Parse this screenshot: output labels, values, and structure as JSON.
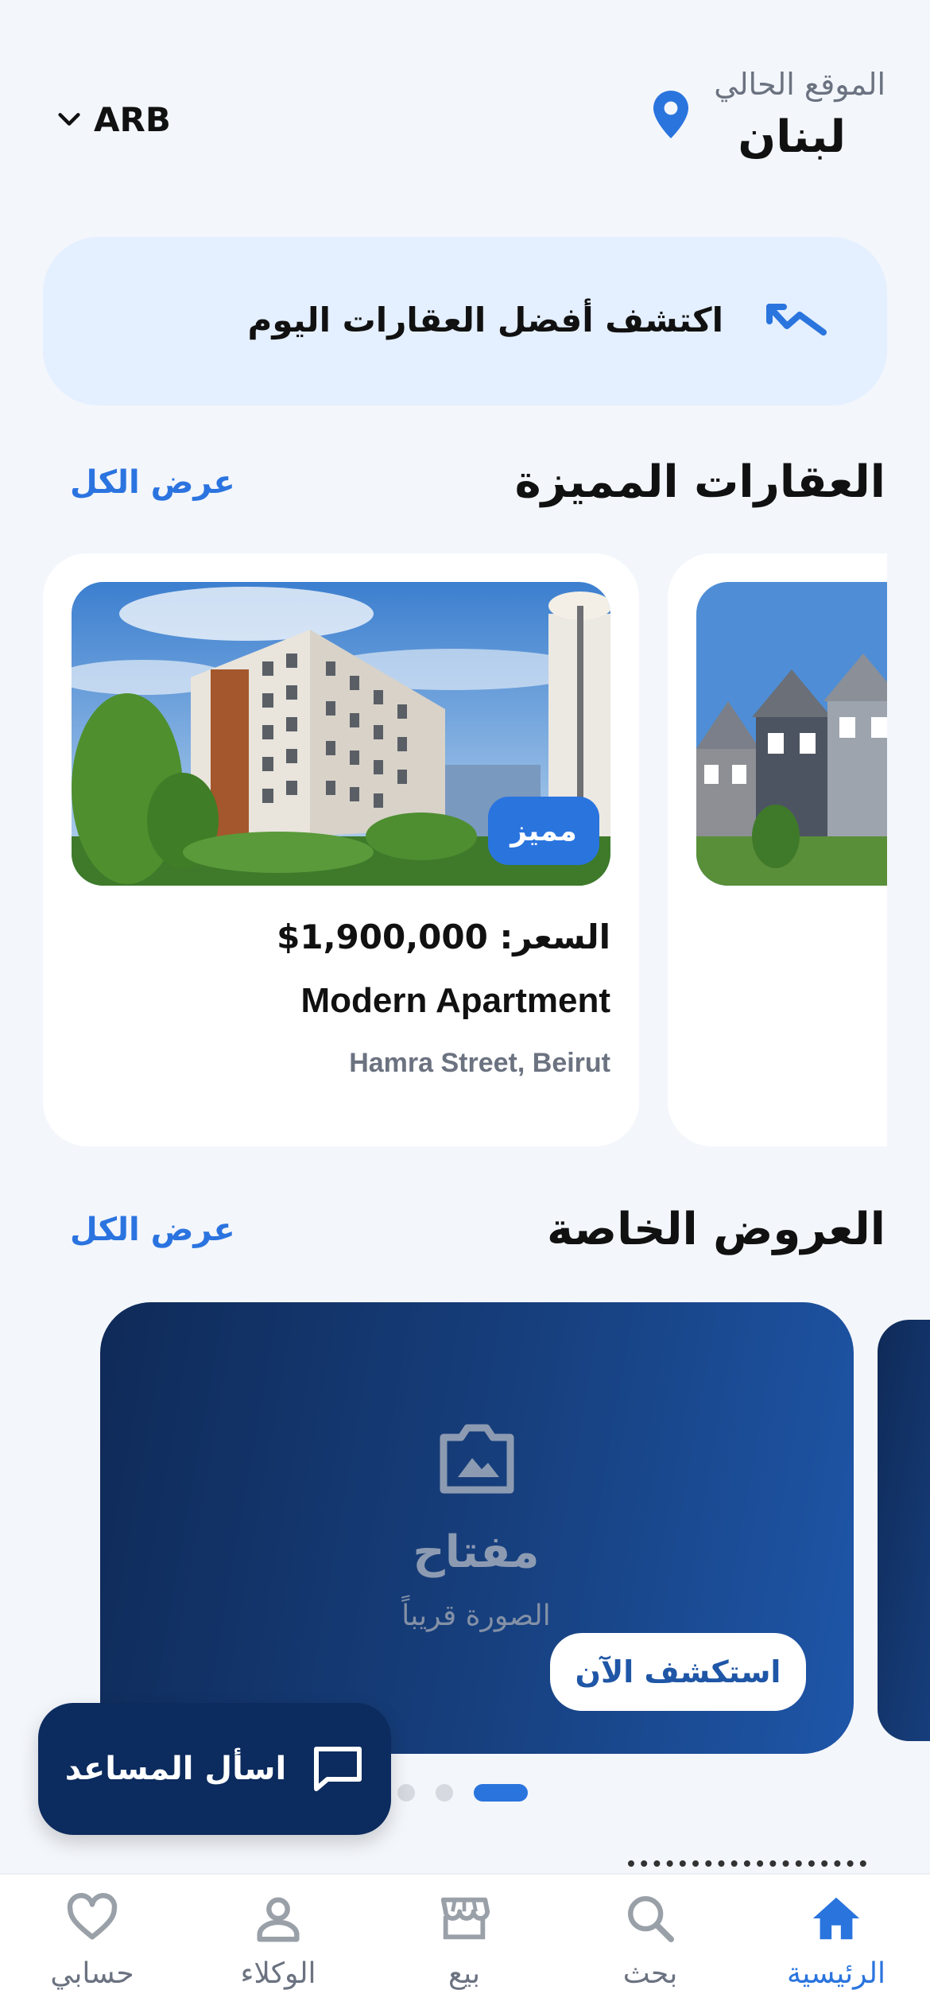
{
  "header": {
    "location_label": "الموقع الحالي",
    "location_value": "لبنان",
    "language_code": "ARB"
  },
  "banner": {
    "text": "اكتشف أفضل العقارات اليوم"
  },
  "featured": {
    "title": "العقارات المميزة",
    "view_all": "عرض الكل",
    "cards": [
      {
        "badge": "مميز",
        "price": "السعر: 1,900,000$",
        "name": "Modern Apartment",
        "address": "Hamra Street, Beirut"
      }
    ]
  },
  "offers": {
    "title": "العروض الخاصة",
    "view_all": "عرض الكل",
    "card": {
      "title": "مفتاح",
      "subtitle": "الصورة قريباً",
      "button": "استكشف الآن"
    },
    "carousel_active_index": 0,
    "carousel_count": 3
  },
  "chat": {
    "label": "اسأل المساعد"
  },
  "nav": {
    "items": [
      {
        "label": "الرئيسية",
        "icon": "home-icon",
        "active": true
      },
      {
        "label": "بحث",
        "icon": "search-icon",
        "active": false
      },
      {
        "label": "بيع",
        "icon": "store-icon",
        "active": false
      },
      {
        "label": "الوكلاء",
        "icon": "person-icon",
        "active": false
      },
      {
        "label": "حسابي",
        "icon": "heart-icon",
        "active": false
      }
    ]
  },
  "colors": {
    "accent": "#2a74de",
    "banner_bg": "#e4efff",
    "offer_dark": "#0f2a58",
    "chat_bg": "#0c2b5e"
  }
}
